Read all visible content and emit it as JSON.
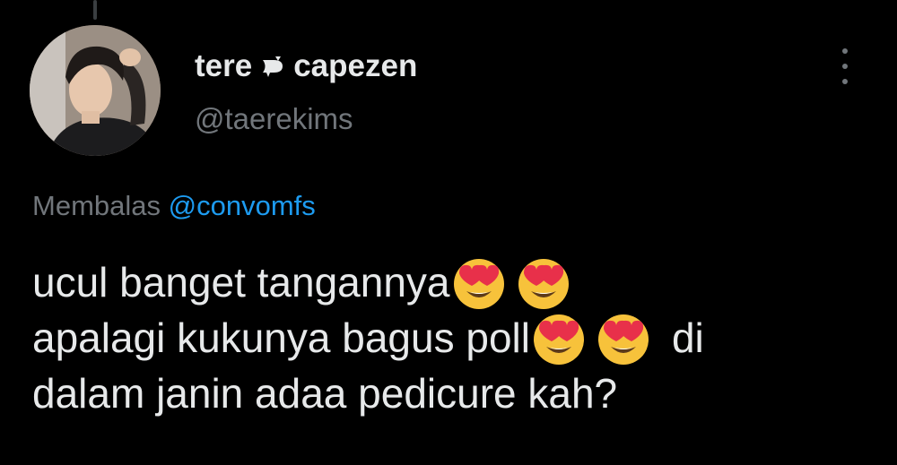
{
  "tweet": {
    "display_name_part1": "tere",
    "display_name_part2": "capezen",
    "name_separator_icon": "cat-paw-icon",
    "handle": "@taerekims",
    "reply_prefix": "Membalas",
    "reply_mention": "@convomfs",
    "text_lines": [
      "ucul banget tangannya",
      "apalagi kukunya bagus poll",
      "di",
      "dalam janin adaa pedicure kah?"
    ],
    "emoji_name": "smiling-face-with-heart-eyes-emoji",
    "accent_color": "#1d9bf0",
    "secondary_text_color": "#71767b"
  }
}
